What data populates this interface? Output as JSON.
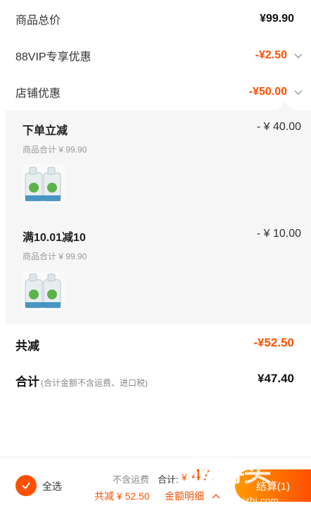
{
  "summary": {
    "goods_total_label": "商品总价",
    "goods_total_value": "¥99.90",
    "vip_label": "88VIP专享优惠",
    "vip_value": "-¥2.50",
    "shop_label": "店铺优惠",
    "shop_value": "-¥50.00"
  },
  "promotions": [
    {
      "title": "下单立减",
      "amount": "- ¥ 40.00",
      "subtitle": "商品合计 ¥ 99.90",
      "thumb_icon": "detergent-bottles"
    },
    {
      "title": "满10.01减10",
      "amount": "- ¥ 10.00",
      "subtitle": "商品合计 ¥ 99.90",
      "thumb_icon": "detergent-bottles"
    }
  ],
  "totals": {
    "reduced_label": "共减",
    "reduced_value": "-¥52.50",
    "sum_label": "合计",
    "sum_note": "(合计金额不含运费、进口税)",
    "sum_value": "¥47.40"
  },
  "bottom_bar": {
    "select_all": "全选",
    "freight_note": "不含运费",
    "total_label": "合计:",
    "currency": "¥",
    "total_amount": "47.",
    "reduce_text": "共减 ¥ 52.50",
    "detail_link": "金额明细",
    "settle_label": "结算(1)"
  },
  "watermark": {
    "main": "值得买",
    "site": "zhizhizhi.com"
  },
  "colors": {
    "accent": "#ff5000",
    "gradient_start": "#ff9a00",
    "panel_bg": "#f6f6f6"
  }
}
